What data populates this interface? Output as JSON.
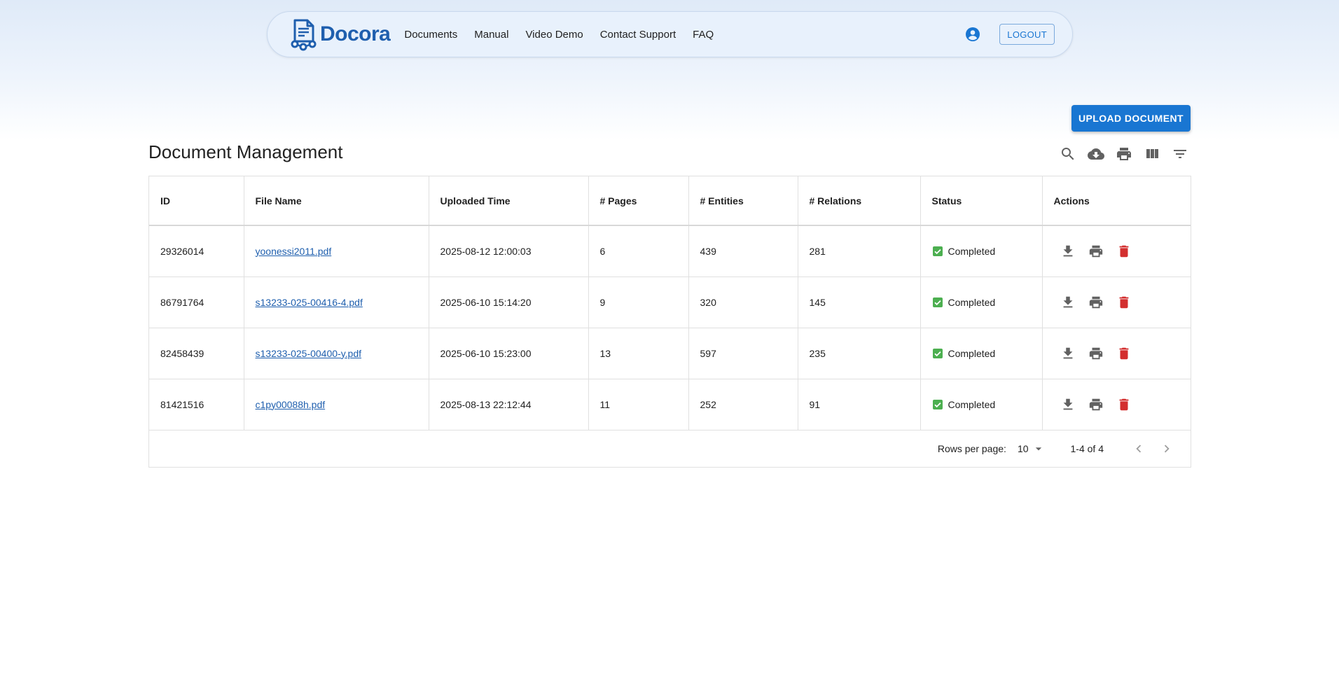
{
  "brand": {
    "name": "Docora",
    "accent": "#1976d2",
    "logo_color": "#1f5fae"
  },
  "nav": {
    "links": [
      "Documents",
      "Manual",
      "Video Demo",
      "Contact Support",
      "FAQ"
    ],
    "user_icon": "account-circle-icon",
    "logout_label": "LOGOUT"
  },
  "upload_label": "UPLOAD DOCUMENT",
  "page_title": "Document Management",
  "toolbar_icons": [
    "search-icon",
    "cloud-download-icon",
    "print-icon",
    "view-column-icon",
    "filter-icon"
  ],
  "table": {
    "columns": [
      "ID",
      "File Name",
      "Uploaded Time",
      "# Pages",
      "# Entities",
      "# Relations",
      "Status",
      "Actions"
    ],
    "rows": [
      {
        "id": "29326014",
        "file": "yoonessi2011.pdf",
        "time": "2025-08-12 12:00:03",
        "pages": "6",
        "entities": "439",
        "relations": "281",
        "status": "Completed"
      },
      {
        "id": "86791764",
        "file": "s13233-025-00416-4.pdf",
        "time": "2025-06-10 15:14:20",
        "pages": "9",
        "entities": "320",
        "relations": "145",
        "status": "Completed"
      },
      {
        "id": "82458439",
        "file": "s13233-025-00400-y.pdf",
        "time": "2025-06-10 15:23:00",
        "pages": "13",
        "entities": "597",
        "relations": "235",
        "status": "Completed"
      },
      {
        "id": "81421516",
        "file": "c1py00088h.pdf",
        "time": "2025-08-13 22:12:44",
        "pages": "11",
        "entities": "252",
        "relations": "91",
        "status": "Completed"
      }
    ],
    "status_color": "#4caf50",
    "delete_color": "#d32f2f"
  },
  "pagination": {
    "rows_per_page_label": "Rows per page:",
    "rows_per_page": "10",
    "range": "1-4 of 4"
  }
}
